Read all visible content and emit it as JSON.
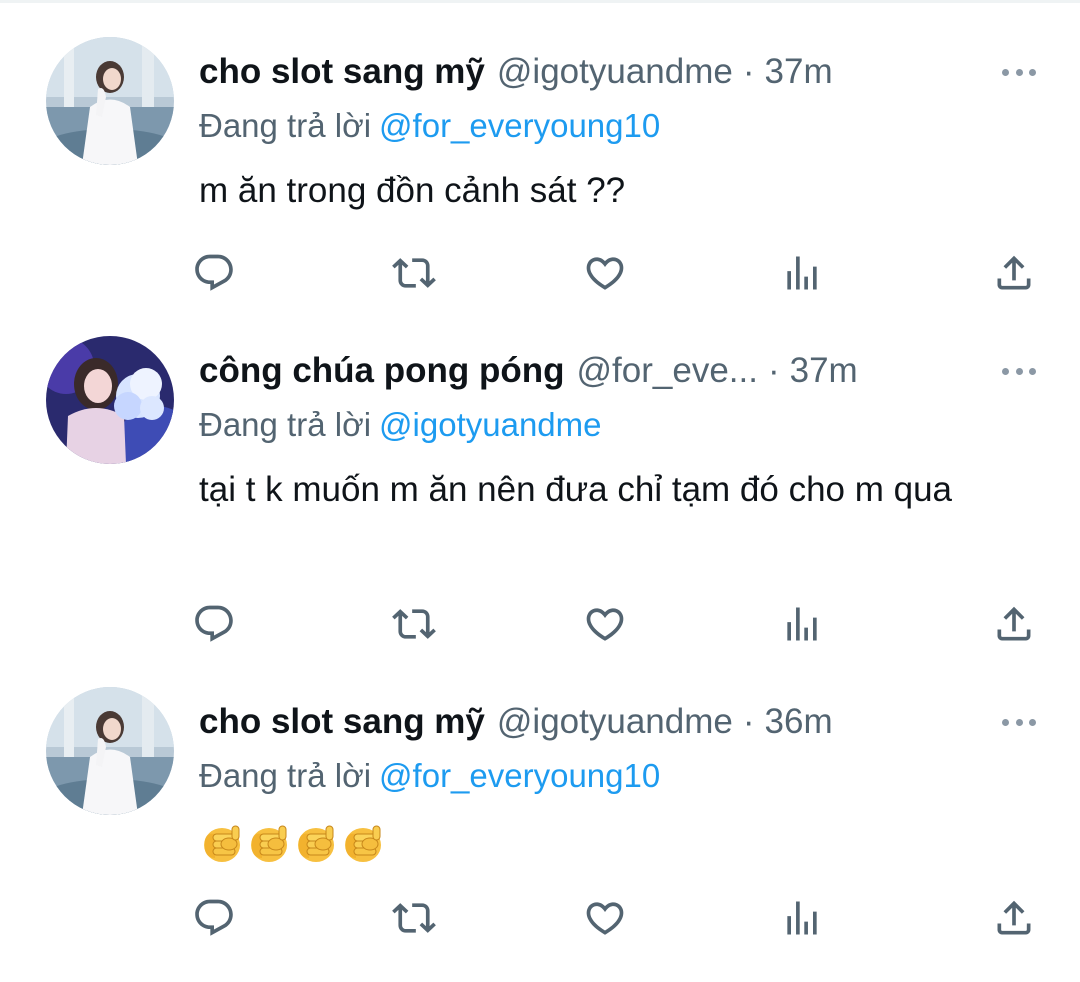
{
  "reply_label": "Đang trả lời",
  "colors": {
    "link": "#1d9bf0",
    "secondary": "#536471",
    "text": "#0f1419"
  },
  "tweets": [
    {
      "display_name": "cho slot sang mỹ",
      "handle": "@igotyuandme",
      "separator": "·",
      "time": "37m",
      "replying_to": "@for_everyoung10",
      "text": "m ăn trong đồn cảnh sát ??",
      "avatar": "avatar-white-dress-icon"
    },
    {
      "display_name": "công chúa pong póng",
      "handle": "@for_eve...",
      "separator": "·",
      "time": "37m",
      "replying_to": "@igotyuandme",
      "text": "tại t k muốn m ăn nên đưa chỉ tạm đó cho m qua",
      "avatar": "avatar-blue-flower-icon"
    },
    {
      "display_name": "cho slot sang mỹ",
      "handle": "@igotyuandme",
      "separator": "·",
      "time": "36m",
      "replying_to": "@for_everyoung10",
      "text": "",
      "emoji": [
        "backhand-index-pointing-at-viewer",
        "backhand-index-pointing-at-viewer",
        "backhand-index-pointing-at-viewer",
        "backhand-index-pointing-at-viewer"
      ],
      "avatar": "avatar-white-dress-icon"
    }
  ],
  "action_icons": [
    "reply-icon",
    "retweet-icon",
    "like-icon",
    "views-icon",
    "share-icon"
  ]
}
